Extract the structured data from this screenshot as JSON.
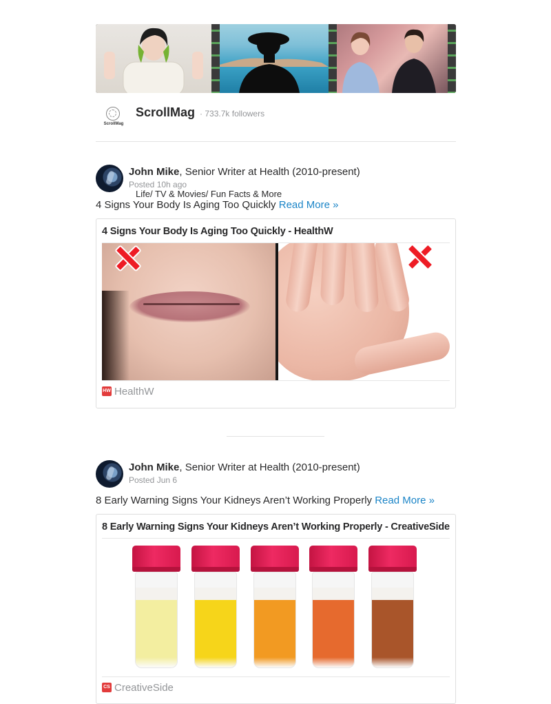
{
  "channel": {
    "name": "ScrollMag",
    "followers": "· 733.7k followers",
    "description": "Life/ TV & Movies/ Fun Facts & More",
    "logo_text": "ScrollMag"
  },
  "posts": [
    {
      "author_name": "John Mike",
      "author_credential": ", Senior Writer at Health (2010-present)",
      "posted": "Posted 10h ago",
      "text": "4 Signs Your Body Is Aging Too Quickly",
      "read_more": "Read More »",
      "card_title": "4 Signs Your Body Is Aging Too Quickly - HealthW",
      "source": "HealthW",
      "source_icon": "HW"
    },
    {
      "author_name": "John Mike",
      "author_credential": ", Senior Writer at Health (2010-present)",
      "posted": "Posted Jun 6",
      "text": "8 Early Warning Signs Your Kidneys Aren’t Working Properly",
      "read_more": "Read More »",
      "card_title": "8 Early Warning Signs Your Kidneys Aren’t Working Properly - CreativeSide",
      "source": "CreativeSide",
      "source_icon": "CS"
    }
  ],
  "colors": {
    "link": "#1a84c7",
    "cap": "#e8245a",
    "urine": [
      "#f3eea0",
      "#f6d51a",
      "#f29a22",
      "#e66a2e",
      "#a9552a"
    ]
  },
  "icons": [
    "x-mark-icon",
    "source-icon"
  ]
}
